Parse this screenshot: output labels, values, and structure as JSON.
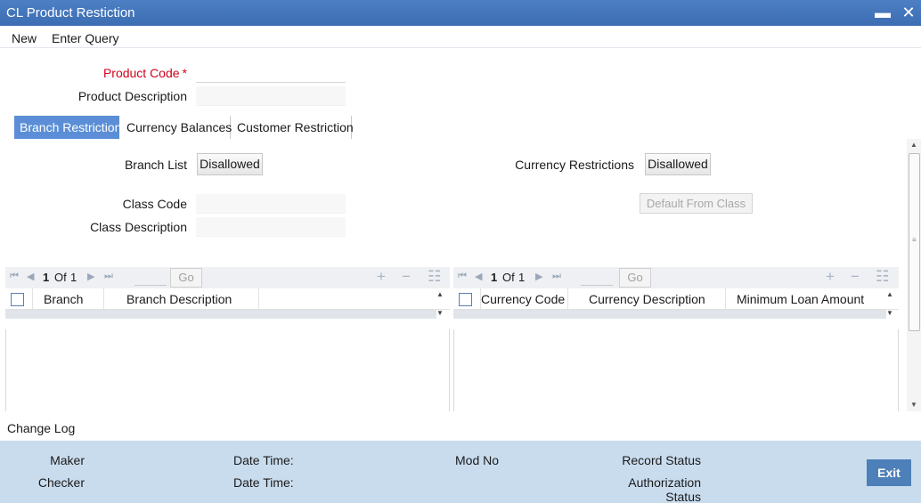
{
  "window": {
    "title": "CL Product Restiction",
    "minimize_label": "▬",
    "close_label": "✕"
  },
  "menu": {
    "new_label": "New",
    "enter_query_label": "Enter Query"
  },
  "header": {
    "product_code_label": "Product Code",
    "required_marker": "*",
    "product_code_value": "",
    "product_description_label": "Product Description",
    "product_description_value": ""
  },
  "tabs": [
    {
      "label": "Branch Restriction",
      "active": true
    },
    {
      "label": "Currency Balances",
      "active": false
    },
    {
      "label": "Customer Restriction",
      "active": false
    }
  ],
  "branch_section": {
    "branch_list_label": "Branch List",
    "branch_list_button": "Disallowed",
    "class_code_label": "Class Code",
    "class_code_value": "",
    "class_description_label": "Class Description",
    "class_description_value": ""
  },
  "currency_section": {
    "currency_restrictions_label": "Currency Restrictions",
    "currency_restrictions_button": "Disallowed",
    "default_from_class_button": "Default From Class"
  },
  "branch_grid": {
    "page_current": "1",
    "page_of": "Of",
    "page_total": "1",
    "go_label": "Go",
    "columns": [
      "Branch",
      "Branch Description"
    ]
  },
  "currency_grid": {
    "page_current": "1",
    "page_of": "Of",
    "page_total": "1",
    "go_label": "Go",
    "columns": [
      "Currency Code",
      "Currency Description",
      "Minimum Loan Amount"
    ]
  },
  "footer": {
    "change_log_label": "Change Log",
    "maker_label": "Maker",
    "checker_label": "Checker",
    "date_time_label_1": "Date Time:",
    "date_time_label_2": "Date Time:",
    "mod_no_label": "Mod No",
    "record_status_label": "Record Status",
    "authorization_label": "Authorization",
    "status_label": "Status",
    "exit_label": "Exit"
  },
  "icons": {
    "first_page": "first-page-icon",
    "prev_page": "prev-page-icon",
    "next_page": "next-page-icon",
    "last_page": "last-page-icon",
    "add_row": "add-row-icon",
    "delete_row": "delete-row-icon",
    "single_view": "single-view-icon"
  },
  "colors": {
    "titlebar": "#3c6db3",
    "active_tab": "#5b8ed6",
    "required": "#d0021b",
    "footer_bg": "#c9dcee",
    "exit_button": "#4d7fb8"
  }
}
